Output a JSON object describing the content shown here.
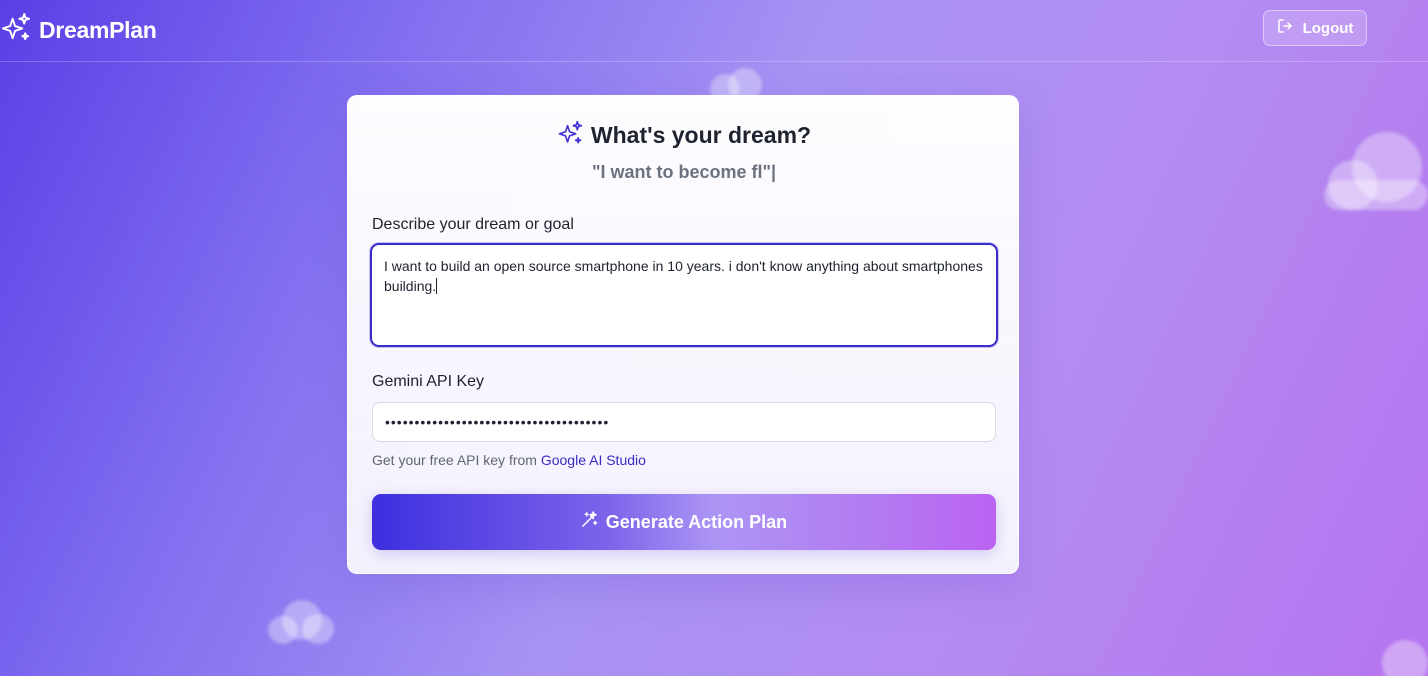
{
  "header": {
    "app_name": "DreamPlan",
    "logo_icon": "sparkles-icon",
    "logout_label": "Logout",
    "logout_icon": "logout-icon"
  },
  "card": {
    "title": "What's your dream?",
    "title_icon": "sparkles-icon",
    "typing_text": "\"I want to become fl\"|",
    "dream_label": "Describe your dream or goal",
    "dream_value": "I want to build an open source smartphone in 10 years. i don't know anything about smartphones building.",
    "api_label": "Gemini API Key",
    "api_value": "••••••••••••••••••••••••••••••••••••••",
    "hint_text": "Get your free API key from ",
    "hint_link": "Google AI Studio",
    "generate_label": "Generate Action Plan",
    "generate_icon": "magic-wand-icon"
  },
  "colors": {
    "accent": "#3b2cc9",
    "link": "#3a2cc3",
    "background_start": "#5a3fe6",
    "background_end": "#b574ef"
  }
}
